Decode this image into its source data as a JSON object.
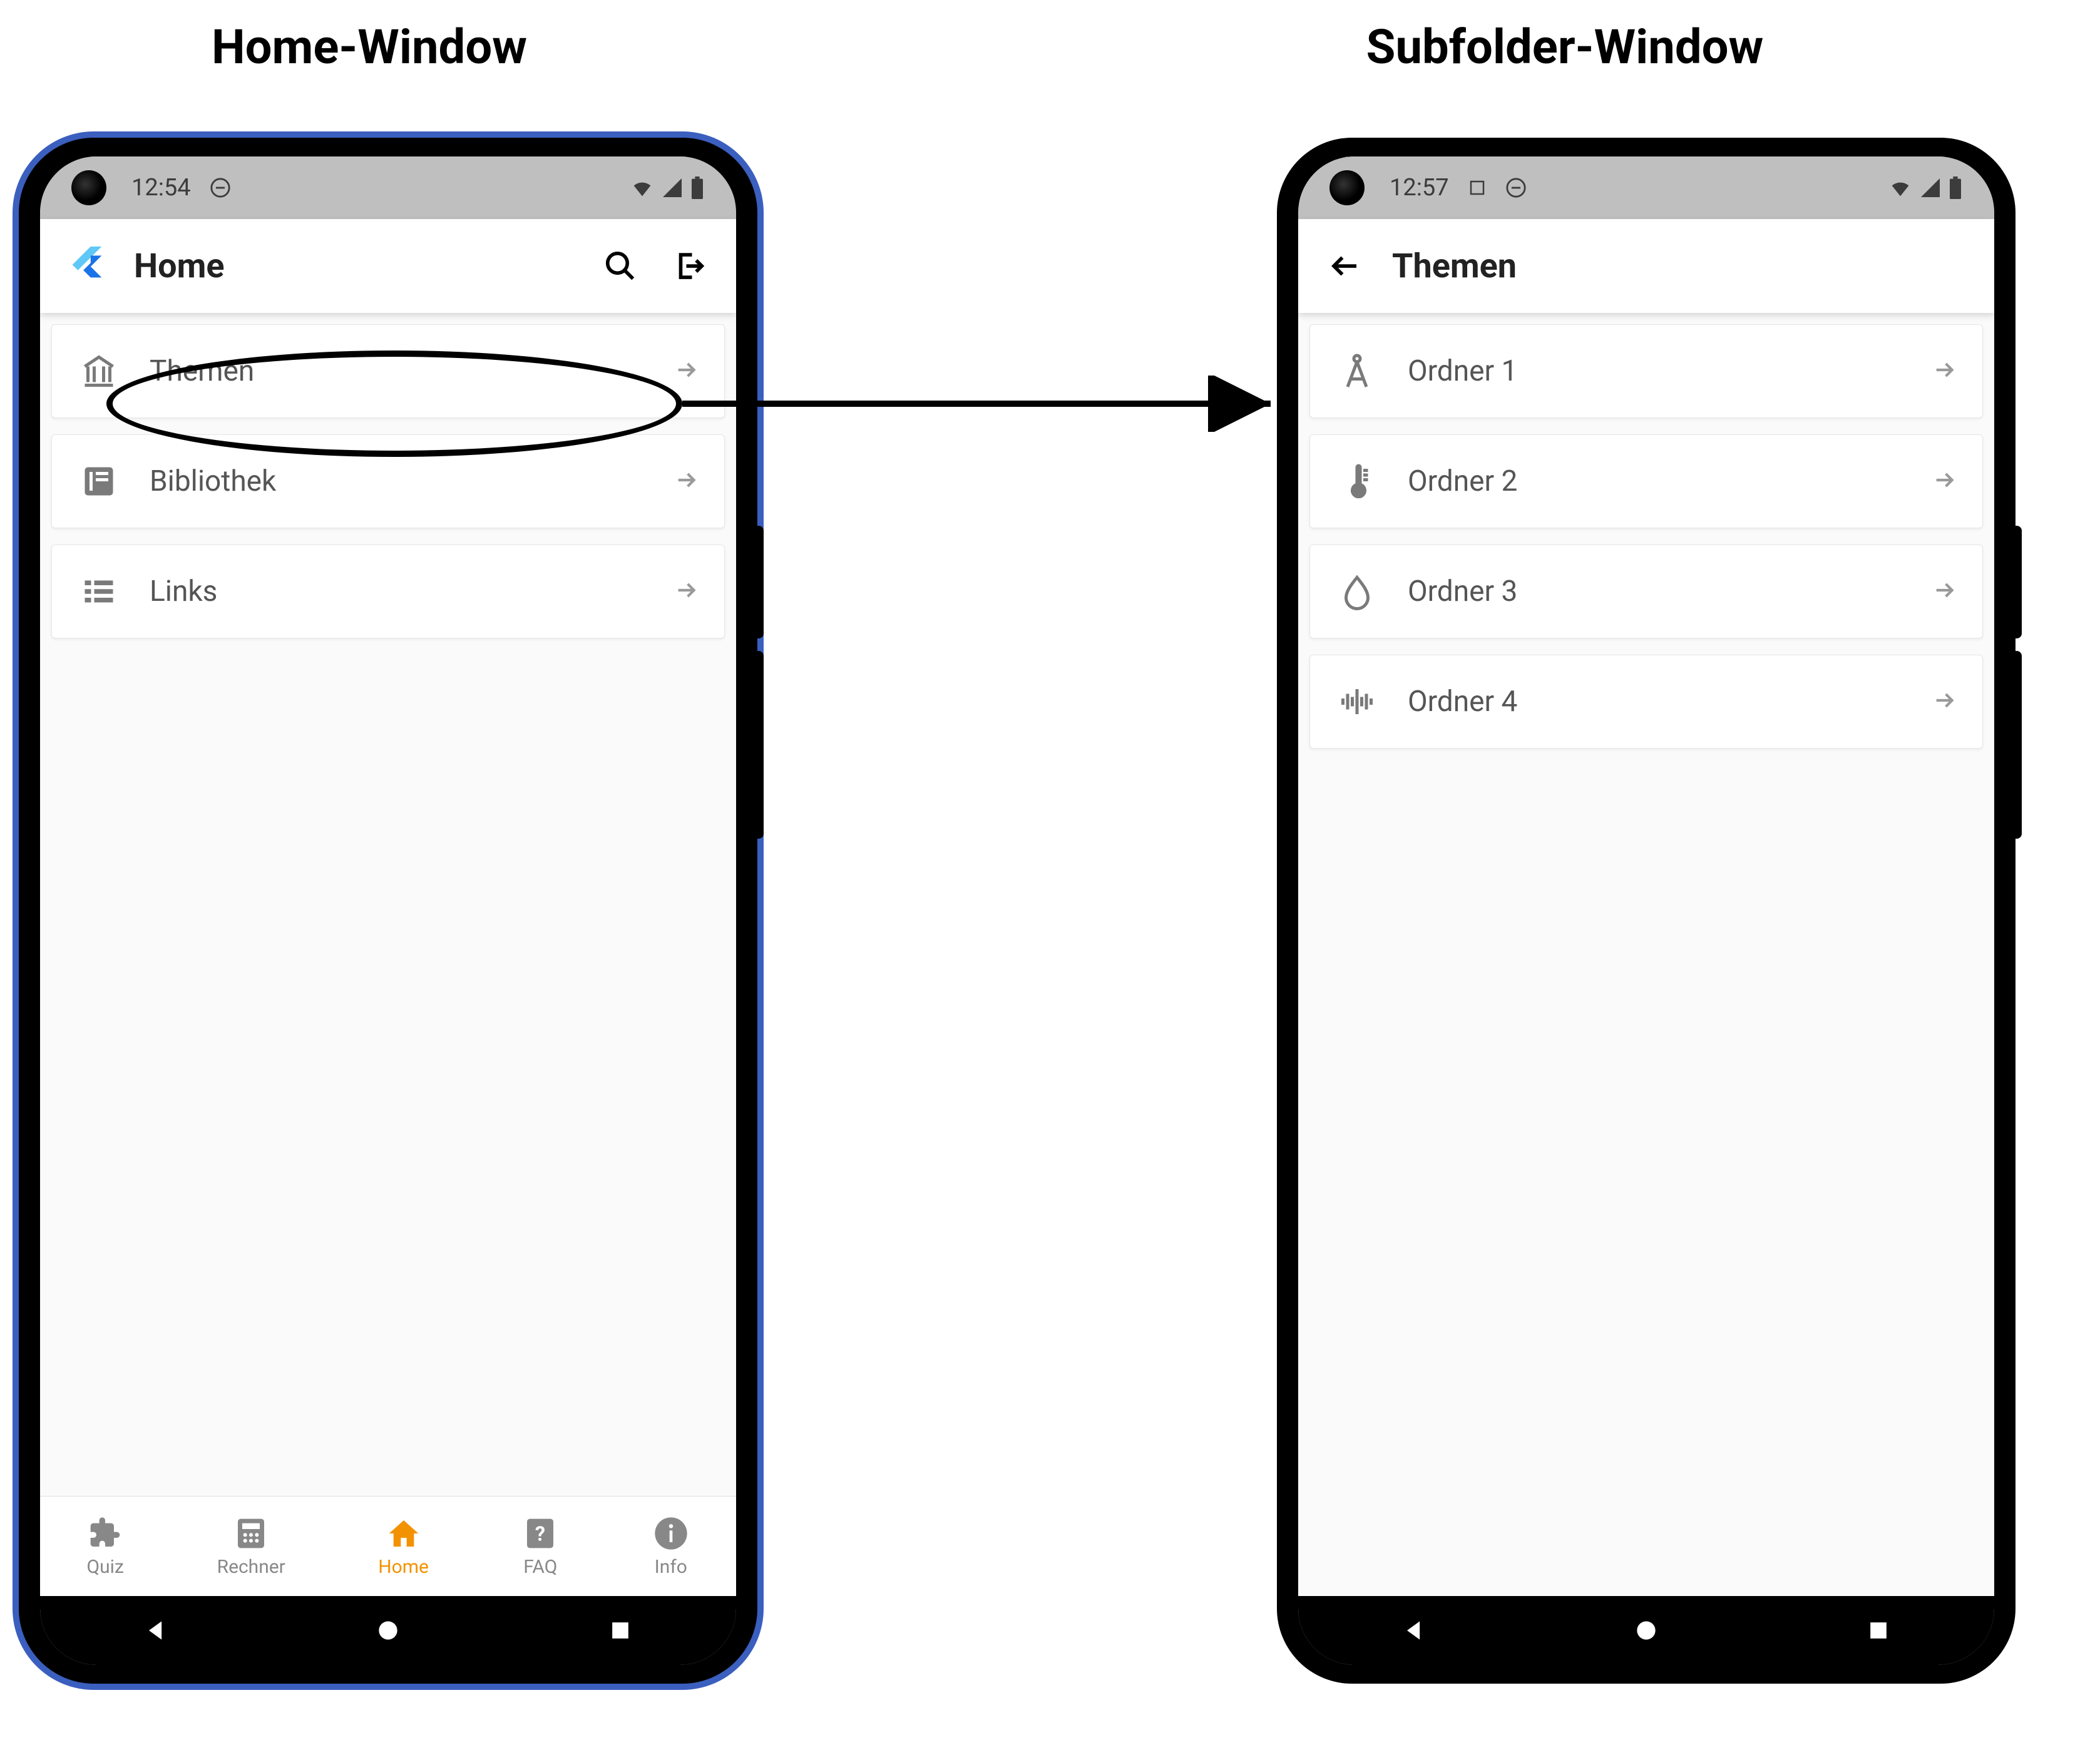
{
  "headings": {
    "left": "Home-Window",
    "right": "Subfolder-Window"
  },
  "homeScreen": {
    "statusbar": {
      "time": "12:54"
    },
    "appbar": {
      "title": "Home"
    },
    "items": [
      {
        "label": "Themen",
        "icon": "museum-icon"
      },
      {
        "label": "Bibliothek",
        "icon": "book-icon"
      },
      {
        "label": "Links",
        "icon": "list-icon"
      }
    ],
    "bottomNav": [
      {
        "label": "Quiz",
        "icon": "puzzle-icon",
        "active": false
      },
      {
        "label": "Rechner",
        "icon": "calculator-icon",
        "active": false
      },
      {
        "label": "Home",
        "icon": "home-icon",
        "active": true
      },
      {
        "label": "FAQ",
        "icon": "question-icon",
        "active": false
      },
      {
        "label": "Info",
        "icon": "info-icon",
        "active": false
      }
    ]
  },
  "subfolderScreen": {
    "statusbar": {
      "time": "12:57"
    },
    "appbar": {
      "title": "Themen"
    },
    "items": [
      {
        "label": "Ordner 1",
        "icon": "compass-icon"
      },
      {
        "label": "Ordner 2",
        "icon": "thermometer-icon"
      },
      {
        "label": "Ordner 3",
        "icon": "droplet-icon"
      },
      {
        "label": "Ordner 4",
        "icon": "soundwave-icon"
      }
    ]
  },
  "annotation": {
    "relation": "tap 'Themen' → navigates to Subfolder-Window"
  }
}
